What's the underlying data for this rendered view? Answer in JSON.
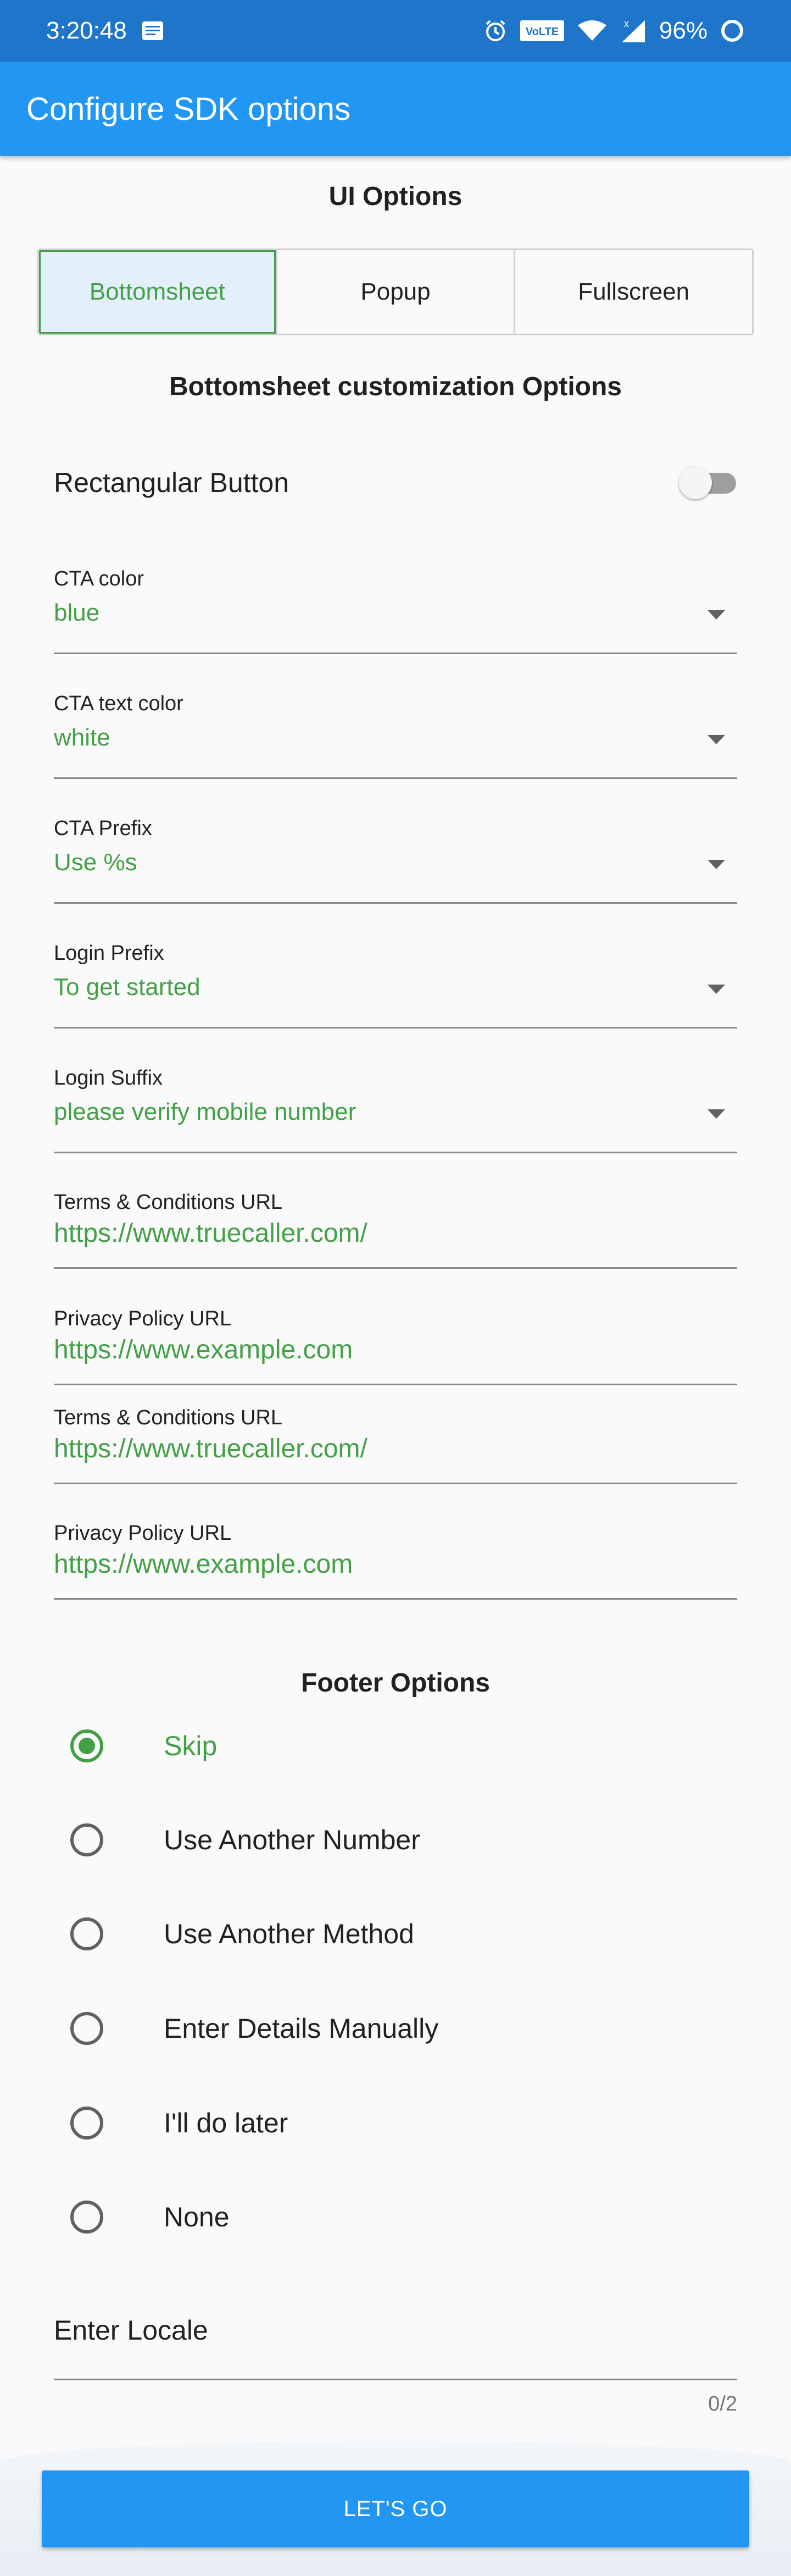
{
  "status_bar": {
    "time": "3:20:48",
    "network_badge": "VoLTE",
    "battery": "96%"
  },
  "app_bar": {
    "title": "Configure SDK options"
  },
  "ui_options": {
    "heading": "UI Options",
    "segments": [
      "Bottomsheet",
      "Popup",
      "Fullscreen"
    ],
    "selected": "Bottomsheet"
  },
  "customization": {
    "heading": "Bottomsheet customization Options",
    "rect_button_label": "Rectangular Button",
    "rect_button_on": false,
    "fields": [
      {
        "label": "CTA color",
        "value": "blue"
      },
      {
        "label": "CTA text color",
        "value": "white"
      },
      {
        "label": "CTA Prefix",
        "value": "Use %s"
      },
      {
        "label": "Login Prefix",
        "value": "To get started"
      },
      {
        "label": "Login Suffix",
        "value": "please verify mobile number"
      }
    ],
    "url_fields": [
      {
        "label": "Terms & Conditions URL",
        "value": "https://www.truecaller.com/"
      },
      {
        "label": "Privacy Policy URL",
        "value": "https://www.example.com"
      },
      {
        "label": "Terms & Conditions URL",
        "value": "https://www.truecaller.com/"
      },
      {
        "label": "Privacy Policy URL",
        "value": "https://www.example.com"
      }
    ]
  },
  "footer_options": {
    "heading": "Footer Options",
    "options": [
      "Skip",
      "Use Another Number",
      "Use Another Method",
      "Enter Details Manually",
      "I'll do later",
      "None"
    ],
    "selected": "Skip"
  },
  "locale": {
    "placeholder": "Enter Locale",
    "counter": "0/2"
  },
  "cta": {
    "label": "LET'S GO"
  },
  "colors": {
    "primary": "#2196f3",
    "status_bar": "#1f75c9",
    "accent_green": "#43a047"
  }
}
